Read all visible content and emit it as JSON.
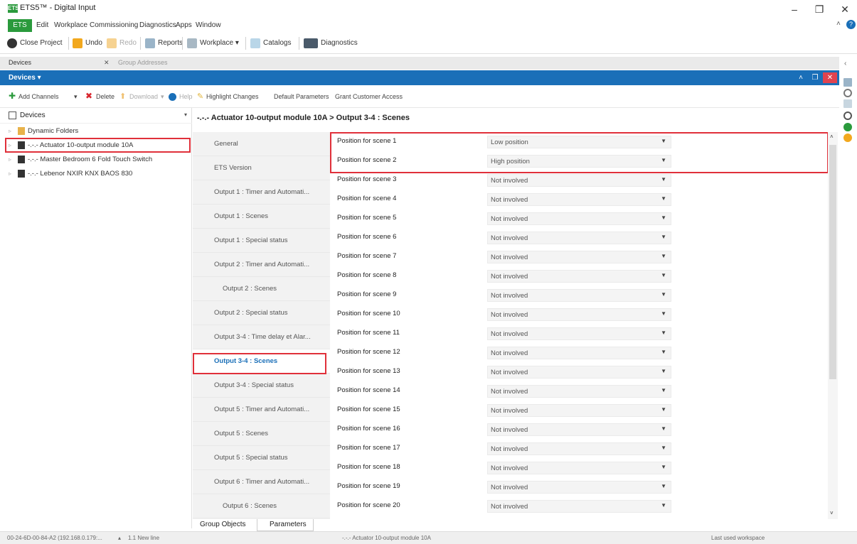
{
  "window": {
    "title": "ETS5™ - Digital Input",
    "logo": "ETS"
  },
  "menu": {
    "ets": "ETS",
    "items": [
      "Edit",
      "Workplace",
      "Commissioning",
      "Diagnostics",
      "Apps",
      "Window"
    ]
  },
  "toolbar": {
    "close_project": "Close Project",
    "undo": "Undo",
    "redo": "Redo",
    "reports": "Reports",
    "workplace": "Workplace ▾",
    "catalogs": "Catalogs",
    "diagnostics": "Diagnostics"
  },
  "doc_tabs": {
    "devices": "Devices",
    "close": "✕",
    "group_addresses": "Group Addresses"
  },
  "panel": {
    "title": "Devices ▾",
    "minimize": "˄",
    "restore": "❐",
    "close": "✕"
  },
  "actions": {
    "add_channels": "Add Channels",
    "delete": "Delete",
    "download": "Download",
    "help": "Help",
    "highlight_changes": "Highlight Changes",
    "default_parameters": "Default Parameters",
    "grant_customer_access": "Grant Customer Access"
  },
  "tree": {
    "header": "Devices",
    "nodes": [
      "Dynamic Folders",
      "-.-.- Actuator 10-output module 10A",
      "-.-.- Master Bedroom  6 Fold Touch Switch",
      "-.-.- Lebenor NXIR KNX BAOS 830"
    ]
  },
  "content_title": "-.-.- Actuator 10-output module 10A > Output 3-4 : Scenes",
  "sections": [
    "General",
    "ETS Version",
    "Output 1 : Timer and Automati...",
    "Output 1 : Scenes",
    "Output 1 : Special status",
    "Output 2 : Timer and Automati...",
    "Output 2 : Scenes",
    "Output 2 : Special status",
    "Output 3-4 : Time delay et Alar...",
    "Output 3-4 : Scenes",
    "Output 3-4 : Special status",
    "Output 5 : Timer and Automati...",
    "Output 5 : Scenes",
    "Output 5 : Special status",
    "Output 6 : Timer and Automati...",
    "Output 6 : Scenes"
  ],
  "active_section": "Output 3-4 : Scenes",
  "params": [
    {
      "label": "Position for scene 1",
      "value": "Low position"
    },
    {
      "label": "Position for scene 2",
      "value": "High position"
    },
    {
      "label": "Position for scene 3",
      "value": "Not involved"
    },
    {
      "label": "Position for scene 4",
      "value": "Not involved"
    },
    {
      "label": "Position for scene 5",
      "value": "Not involved"
    },
    {
      "label": "Position for scene 6",
      "value": "Not involved"
    },
    {
      "label": "Position for scene 7",
      "value": "Not involved"
    },
    {
      "label": "Position for scene 8",
      "value": "Not involved"
    },
    {
      "label": "Position for scene 9",
      "value": "Not involved"
    },
    {
      "label": "Position for scene 10",
      "value": "Not involved"
    },
    {
      "label": "Position for scene 11",
      "value": "Not involved"
    },
    {
      "label": "Position for scene 12",
      "value": "Not involved"
    },
    {
      "label": "Position for scene 13",
      "value": "Not involved"
    },
    {
      "label": "Position for scene 14",
      "value": "Not involved"
    },
    {
      "label": "Position for scene 15",
      "value": "Not involved"
    },
    {
      "label": "Position for scene 16",
      "value": "Not involved"
    },
    {
      "label": "Position for scene 17",
      "value": "Not involved"
    },
    {
      "label": "Position for scene 18",
      "value": "Not involved"
    },
    {
      "label": "Position for scene 19",
      "value": "Not involved"
    },
    {
      "label": "Position for scene 20",
      "value": "Not involved"
    }
  ],
  "bottom_tabs": {
    "group_objects": "Group Objects",
    "parameters": "Parameters"
  },
  "status": {
    "address": "00-24-6D-00-84-A2 (192.168.0.179:...",
    "line": "1.1 New line",
    "device": "-.-.- Actuator 10-output module 10A",
    "workspace": "Last used workspace"
  },
  "colors": {
    "accent": "#1a6fb8",
    "brand": "#2a9a3c",
    "highlight": "#e0303a"
  }
}
